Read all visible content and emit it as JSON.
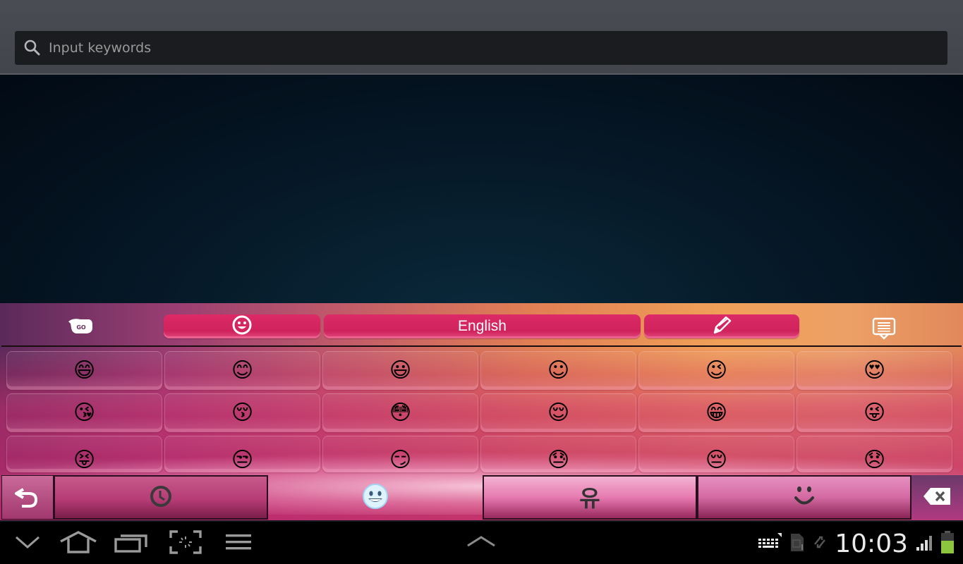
{
  "search": {
    "placeholder": "Input keywords",
    "value": "",
    "icon": "search-icon"
  },
  "keyboard": {
    "top_bar": {
      "logo_text": "GO",
      "emoji_tab_icon": "smiley-face-icon",
      "language_label": "English",
      "handwriting_icon": "pencil-icon",
      "keyboard_toggle_icon": "keyboard-hide-icon"
    },
    "emoji_rows": [
      [
        {
          "name": "smiling-face-open-mouth-smiling-eyes",
          "glyph": "😄"
        },
        {
          "name": "smiling-face-smiling-eyes",
          "glyph": "😊"
        },
        {
          "name": "smiling-face-open-mouth",
          "glyph": "😃"
        },
        {
          "name": "relieved-blushing-face",
          "glyph": "☺"
        },
        {
          "name": "winking-face",
          "glyph": "😉"
        },
        {
          "name": "heart-eyes-face",
          "glyph": "😍"
        }
      ],
      [
        {
          "name": "face-blowing-kiss",
          "glyph": "😘"
        },
        {
          "name": "kissing-face-closed-eyes",
          "glyph": "😚"
        },
        {
          "name": "flushed-face",
          "glyph": "😳"
        },
        {
          "name": "relieved-face",
          "glyph": "😌"
        },
        {
          "name": "grinning-face-smiling-eyes",
          "glyph": "😁"
        },
        {
          "name": "winking-face-tongue",
          "glyph": "😜"
        }
      ],
      [
        {
          "name": "squinting-face-tongue",
          "glyph": "😝"
        },
        {
          "name": "unamused-face",
          "glyph": "😒"
        },
        {
          "name": "smirking-face",
          "glyph": "😏"
        },
        {
          "name": "downcast-face-sweat",
          "glyph": "😓"
        },
        {
          "name": "pensive-face",
          "glyph": "😔"
        },
        {
          "name": "disappointed-face",
          "glyph": "😞"
        }
      ]
    ],
    "bottom_bar": {
      "undo_icon": "undo-arrow-icon",
      "recent_icon": "clock-icon",
      "smileys_icon": "emoji-face-icon",
      "korean_label": "유",
      "faces_label": "ᵔ◡ᵔ",
      "backspace_icon": "backspace-icon"
    }
  },
  "navbar": {
    "buttons": [
      "hide-keyboard",
      "home",
      "recent-apps",
      "screenshot",
      "menu"
    ],
    "center": "expand-up",
    "status": {
      "time": "10:03",
      "icons": [
        "keyboard-icon",
        "sd-card-icon",
        "sync-icon",
        "signal-icon",
        "battery-icon"
      ],
      "battery_color": "#8cc63f"
    }
  },
  "colors": {
    "accent_pink": "#d4235f",
    "header_bg": "#474950",
    "search_bg": "#1b1c1f"
  }
}
